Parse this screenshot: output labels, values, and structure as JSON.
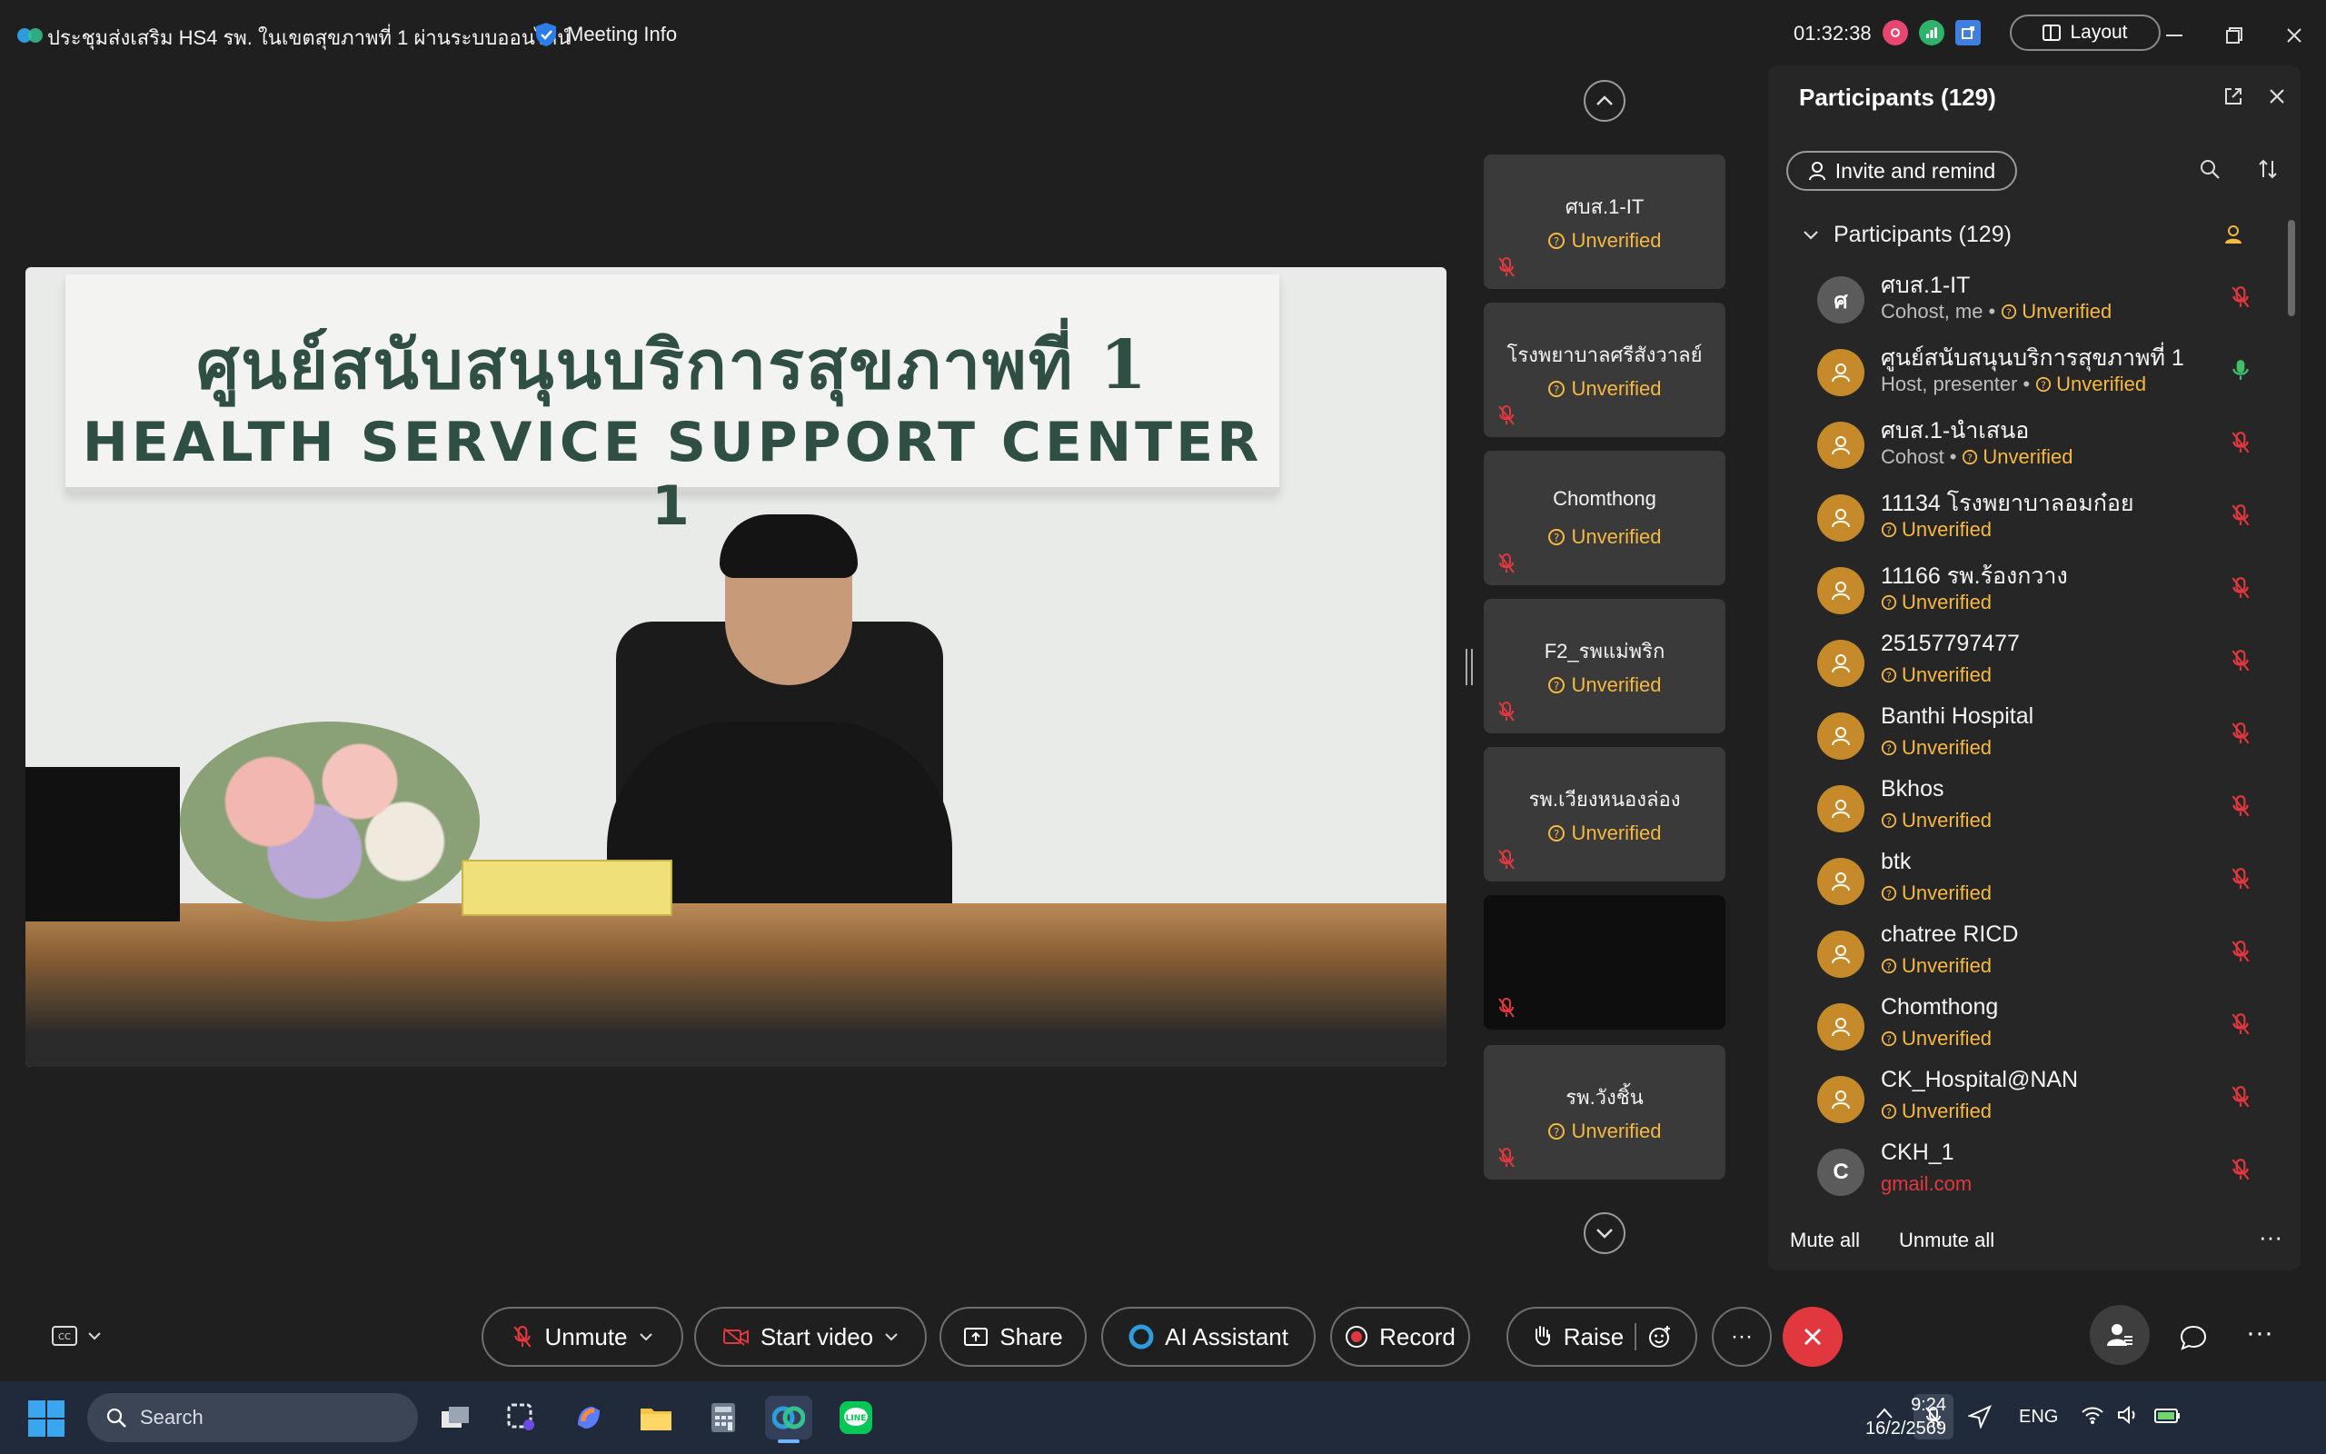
{
  "window": {
    "title": "ประชุมส่งเสริม HS4 รพ. ในเขตสุขภาพที่ 1 ผ่านระบบออนไลน์",
    "meeting_info_label": "Meeting Info",
    "timer": "01:32:38",
    "layout_label": "Layout"
  },
  "main_video": {
    "sign_thai": "ศูนย์สนับสนุนบริการสุขภาพที่ 1",
    "sign_english": "HEALTH SERVICE SUPPORT CENTER 1"
  },
  "thumbnails": [
    {
      "name": "ศบส.1-IT",
      "status": "Unverified"
    },
    {
      "name": "โรงพยาบาลศรีสังวาลย์",
      "status": "Unverified"
    },
    {
      "name": "Chomthong",
      "status": "Unverified"
    },
    {
      "name": "F2_รพแม่พริก",
      "status": "Unverified"
    },
    {
      "name": "รพ.เวียงหนองล่อง",
      "status": "Unverified"
    },
    {
      "name": "",
      "status": ""
    },
    {
      "name": "รพ.วังชิ้น",
      "status": "Unverified"
    }
  ],
  "panel": {
    "title": "Participants (129)",
    "invite_label": "Invite and remind",
    "group_label": "Participants (129)",
    "mute_all": "Mute all",
    "unmute_all": "Unmute all",
    "participants": [
      {
        "name": "ศบส.1-IT",
        "avatar_letter": "ศ",
        "avatar_color": "gray",
        "role": "Cohost, me",
        "status": "Unverified",
        "mic": "muted"
      },
      {
        "name": "ศูนย์สนับสนุนบริการสุขภาพที่ 1",
        "avatar_letter": "",
        "avatar_color": "orange",
        "role": "Host, presenter",
        "status": "Unverified",
        "mic": "active"
      },
      {
        "name": "ศบส.1-นำเสนอ",
        "avatar_letter": "",
        "avatar_color": "orange",
        "role": "Cohost",
        "status": "Unverified",
        "mic": "muted"
      },
      {
        "name": "11134 โรงพยาบาลอมก๋อย",
        "avatar_letter": "",
        "avatar_color": "orange",
        "role": "",
        "status": "Unverified",
        "mic": "muted"
      },
      {
        "name": "11166 รพ.ร้องกวาง",
        "avatar_letter": "",
        "avatar_color": "orange",
        "role": "",
        "status": "Unverified",
        "mic": "muted"
      },
      {
        "name": "25157797477",
        "avatar_letter": "",
        "avatar_color": "orange",
        "role": "",
        "status": "Unverified",
        "mic": "muted"
      },
      {
        "name": "Banthi Hospital",
        "avatar_letter": "",
        "avatar_color": "orange",
        "role": "",
        "status": "Unverified",
        "mic": "muted"
      },
      {
        "name": "Bkhos",
        "avatar_letter": "",
        "avatar_color": "orange",
        "role": "",
        "status": "Unverified",
        "mic": "muted"
      },
      {
        "name": "btk",
        "avatar_letter": "",
        "avatar_color": "orange",
        "role": "",
        "status": "Unverified",
        "mic": "muted"
      },
      {
        "name": "chatree RICD",
        "avatar_letter": "",
        "avatar_color": "orange",
        "role": "",
        "status": "Unverified",
        "mic": "muted"
      },
      {
        "name": "Chomthong",
        "avatar_letter": "",
        "avatar_color": "orange",
        "role": "",
        "status": "Unverified",
        "mic": "muted"
      },
      {
        "name": "CK_Hospital@NAN",
        "avatar_letter": "",
        "avatar_color": "orange",
        "role": "",
        "status": "Unverified",
        "mic": "muted"
      },
      {
        "name": "CKH_1",
        "avatar_letter": "C",
        "avatar_color": "gray",
        "role": "gmail.com",
        "status": "",
        "mic": "muted"
      }
    ]
  },
  "controls": {
    "unmute": "Unmute",
    "start_video": "Start video",
    "share": "Share",
    "ai_assistant": "AI Assistant",
    "record": "Record",
    "raise": "Raise"
  },
  "taskbar": {
    "search_placeholder": "Search",
    "language": "ENG",
    "time": "9:24",
    "date": "16/2/2569"
  },
  "colors": {
    "background": "#1f1f1f",
    "panel": "#262626",
    "unverified": "#f5b942",
    "muted_mic": "#e0383e",
    "active_mic": "#3fbf6a",
    "end_call": "#e0383e",
    "taskbar": "#202a3a"
  },
  "icons": {
    "meeting_info": "shield-icon",
    "layout": "layout-icon",
    "invite": "person-icon",
    "search": "search-icon",
    "sort": "sort-icon",
    "popout": "popout-icon",
    "close": "close-icon"
  }
}
